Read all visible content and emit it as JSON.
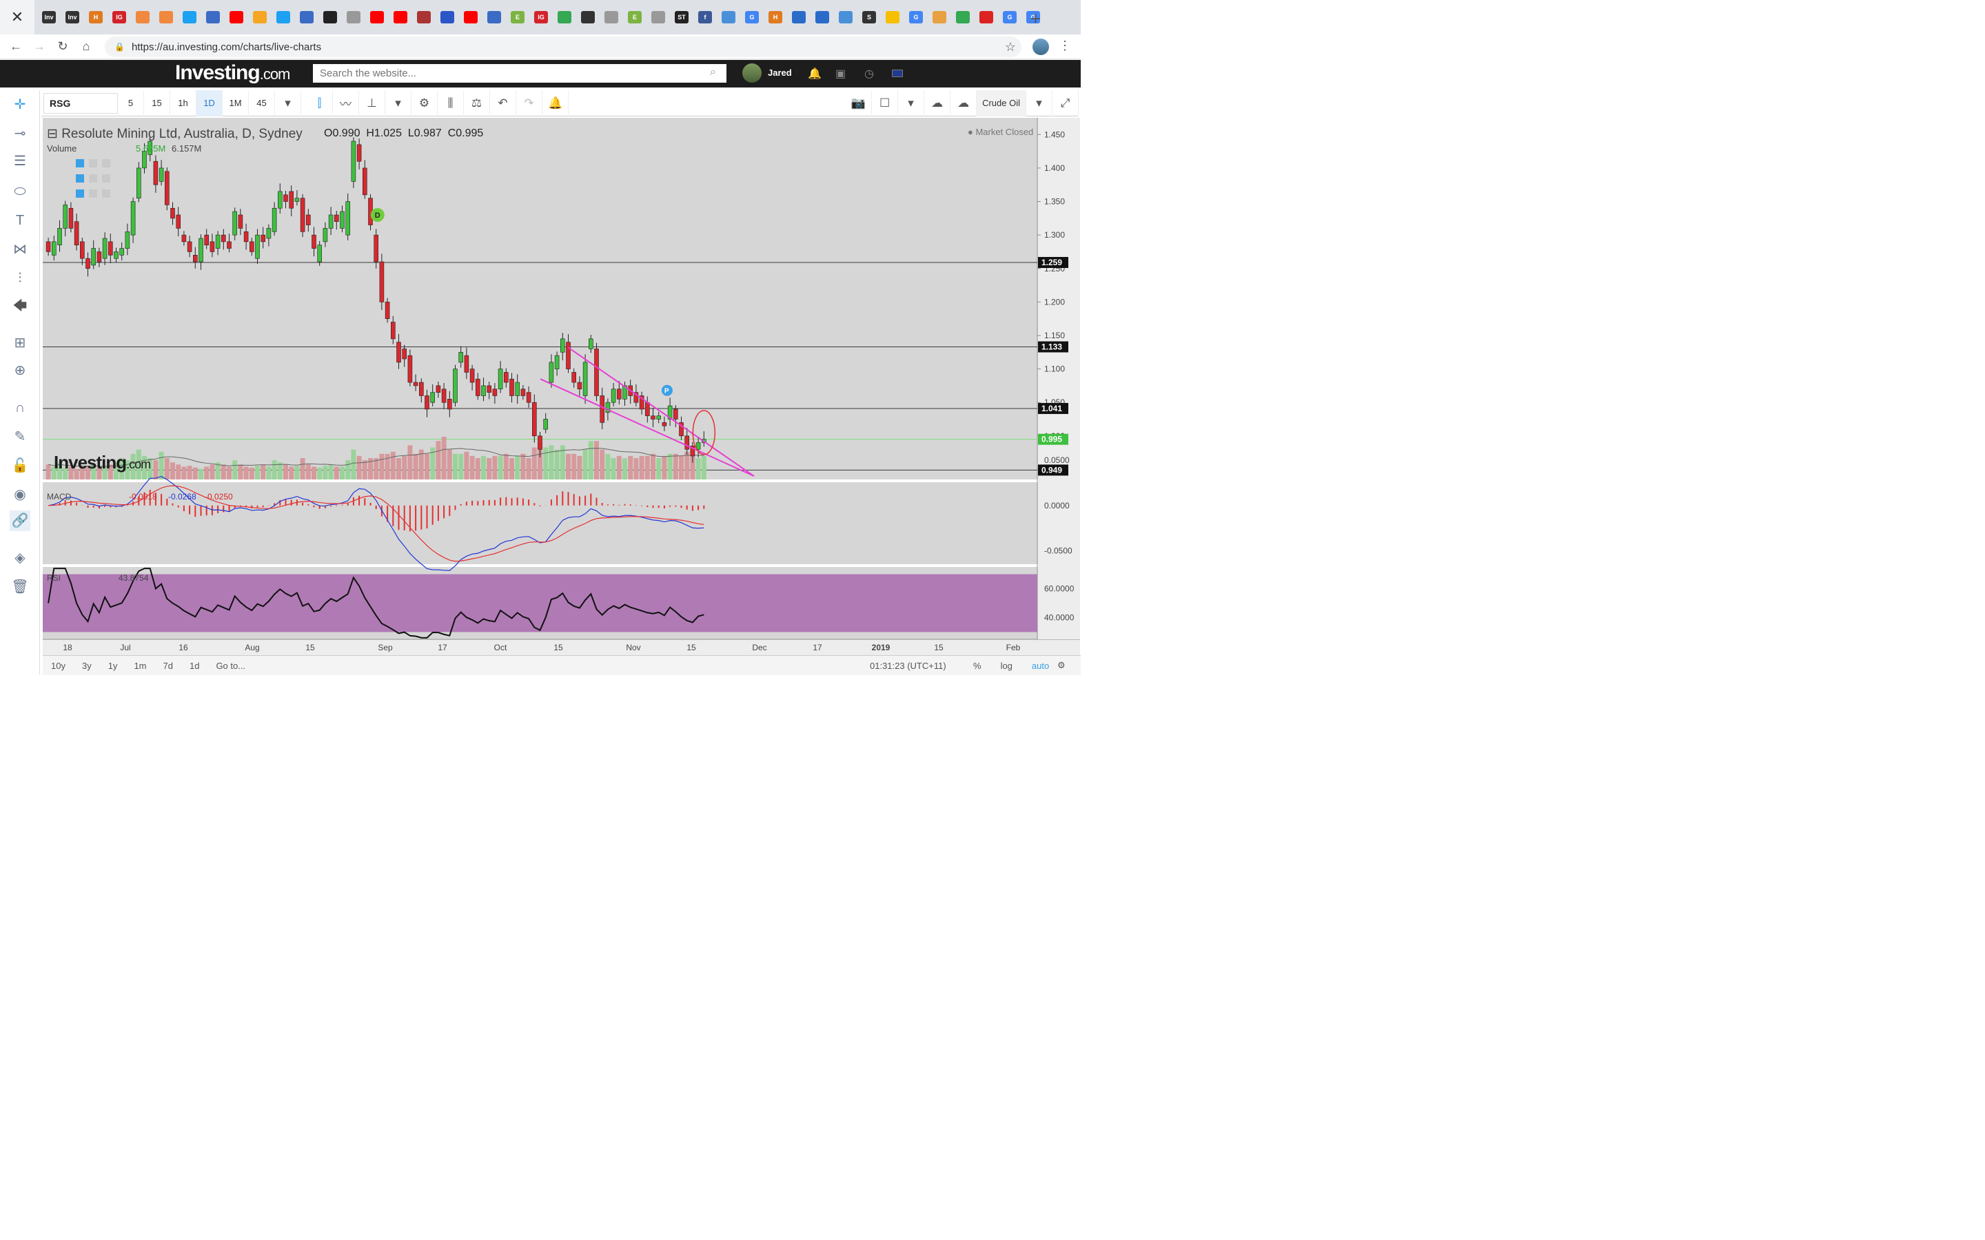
{
  "browser": {
    "url": "https://au.investing.com/charts/live-charts",
    "tab_icons": [
      {
        "label": "Inv",
        "color": "#333"
      },
      {
        "label": "Inv",
        "color": "#333"
      },
      {
        "label": "H",
        "color": "#e07a1f"
      },
      {
        "label": "IG",
        "color": "#d2232a"
      },
      {
        "label": "",
        "color": "#f0883e"
      },
      {
        "label": "",
        "color": "#f0883e"
      },
      {
        "label": "",
        "color": "#1da1f2"
      },
      {
        "label": "",
        "color": "#3b6bc4"
      },
      {
        "label": "",
        "color": "#ff0000"
      },
      {
        "label": "",
        "color": "#f5a623"
      },
      {
        "label": "",
        "color": "#1da1f2"
      },
      {
        "label": "",
        "color": "#3b6bc4"
      },
      {
        "label": "",
        "color": "#222"
      },
      {
        "label": "",
        "color": "#999"
      },
      {
        "label": "",
        "color": "#ff0000"
      },
      {
        "label": "",
        "color": "#ff0000"
      },
      {
        "label": "",
        "color": "#a33"
      },
      {
        "label": "",
        "color": "#2b56c8"
      },
      {
        "label": "",
        "color": "#ff0000"
      },
      {
        "label": "",
        "color": "#3b6bc4"
      },
      {
        "label": "E",
        "color": "#7cb342"
      },
      {
        "label": "IG",
        "color": "#d2232a"
      },
      {
        "label": "",
        "color": "#34a853"
      },
      {
        "label": "",
        "color": "#333"
      },
      {
        "label": "",
        "color": "#999"
      },
      {
        "label": "E",
        "color": "#7cb342"
      },
      {
        "label": "",
        "color": "#999"
      },
      {
        "label": "ST",
        "color": "#222"
      },
      {
        "label": "f",
        "color": "#3b5998"
      },
      {
        "label": "",
        "color": "#4a90d9"
      },
      {
        "label": "G",
        "color": "#4285f4"
      },
      {
        "label": "H",
        "color": "#e07a1f"
      },
      {
        "label": "",
        "color": "#2a6bc9"
      },
      {
        "label": "",
        "color": "#2a6bc9"
      },
      {
        "label": "",
        "color": "#4a90d9"
      },
      {
        "label": "S",
        "color": "#333"
      },
      {
        "label": "",
        "color": "#f6c000"
      },
      {
        "label": "G",
        "color": "#4285f4"
      },
      {
        "label": "",
        "color": "#e8a040"
      },
      {
        "label": "",
        "color": "#34a853"
      },
      {
        "label": "",
        "color": "#d22"
      },
      {
        "label": "G",
        "color": "#4285f4"
      },
      {
        "label": "G",
        "color": "#4285f4"
      }
    ]
  },
  "site": {
    "logo": "Investing",
    "logo_suffix": ".com",
    "search_placeholder": "Search the website...",
    "user": "Jared"
  },
  "toolbar": {
    "symbol": "RSG",
    "intervals": [
      "5",
      "15",
      "1h",
      "1D",
      "1M",
      "45"
    ],
    "active_interval": "1D",
    "instrument": "Crude Oil"
  },
  "legend": {
    "title": "Resolute Mining Ltd, Australia, D, Sydney",
    "open": "O0.990",
    "high": "H1.025",
    "low": "L0.987",
    "close": "C0.995",
    "market_status": "Market Closed",
    "volume_label": "Volume",
    "volume_v1": "5.625M",
    "volume_v2": "6.157M",
    "macd_label": "MACD",
    "macd_v1": "-0.0018",
    "macd_v2": "-0.0268",
    "macd_v3": "-0.0250",
    "rsi_label": "RSI",
    "rsi_value": "43.8754",
    "watermark": "Investing",
    "watermark_suffix": ".com"
  },
  "chart_data": {
    "type": "candlestick",
    "title": "Resolute Mining Ltd, Australia, D, Sydney",
    "y_range": [
      0.935,
      1.475
    ],
    "y_ticks": [
      "1.450",
      "1.400",
      "1.350",
      "1.300",
      "1.250",
      "1.200",
      "1.150",
      "1.100",
      "1.050",
      "1.000",
      "0.950"
    ],
    "price_labels": [
      {
        "value": 1.259,
        "label": "1.259",
        "style": "black"
      },
      {
        "value": 1.133,
        "label": "1.133",
        "style": "black"
      },
      {
        "value": 1.041,
        "label": "1.041",
        "style": "black"
      },
      {
        "value": 0.995,
        "label": "0.995",
        "style": "green"
      },
      {
        "value": 0.949,
        "label": "0.949",
        "style": "black"
      }
    ],
    "x_labels": [
      "18",
      "Jul",
      "16",
      "Aug",
      "15",
      "Sep",
      "17",
      "Oct",
      "15",
      "Nov",
      "15",
      "Dec",
      "17",
      "2019",
      "15",
      "Feb"
    ],
    "candles": [
      [
        1.29,
        1.275
      ],
      [
        1.27,
        1.29
      ],
      [
        1.285,
        1.31
      ],
      [
        1.31,
        1.345
      ],
      [
        1.34,
        1.31
      ],
      [
        1.32,
        1.285
      ],
      [
        1.29,
        1.265
      ],
      [
        1.265,
        1.25
      ],
      [
        1.255,
        1.28
      ],
      [
        1.275,
        1.26
      ],
      [
        1.265,
        1.295
      ],
      [
        1.29,
        1.27
      ],
      [
        1.265,
        1.275
      ],
      [
        1.27,
        1.28
      ],
      [
        1.28,
        1.305
      ],
      [
        1.3,
        1.35
      ],
      [
        1.355,
        1.4
      ],
      [
        1.4,
        1.425
      ],
      [
        1.42,
        1.44
      ],
      [
        1.41,
        1.375
      ],
      [
        1.38,
        1.4
      ],
      [
        1.395,
        1.345
      ],
      [
        1.34,
        1.325
      ],
      [
        1.33,
        1.31
      ],
      [
        1.3,
        1.29
      ],
      [
        1.29,
        1.275
      ],
      [
        1.27,
        1.26
      ],
      [
        1.26,
        1.295
      ],
      [
        1.3,
        1.285
      ],
      [
        1.29,
        1.275
      ],
      [
        1.28,
        1.3
      ],
      [
        1.3,
        1.29
      ],
      [
        1.29,
        1.28
      ],
      [
        1.3,
        1.335
      ],
      [
        1.33,
        1.31
      ],
      [
        1.305,
        1.29
      ],
      [
        1.29,
        1.275
      ],
      [
        1.265,
        1.3
      ],
      [
        1.3,
        1.29
      ],
      [
        1.295,
        1.31
      ],
      [
        1.305,
        1.34
      ],
      [
        1.34,
        1.365
      ],
      [
        1.36,
        1.35
      ],
      [
        1.365,
        1.34
      ],
      [
        1.35,
        1.355
      ],
      [
        1.355,
        1.305
      ],
      [
        1.33,
        1.315
      ],
      [
        1.3,
        1.28
      ],
      [
        1.26,
        1.285
      ],
      [
        1.29,
        1.31
      ],
      [
        1.31,
        1.33
      ],
      [
        1.33,
        1.32
      ],
      [
        1.31,
        1.335
      ],
      [
        1.3,
        1.35
      ],
      [
        1.38,
        1.44
      ],
      [
        1.435,
        1.41
      ],
      [
        1.4,
        1.36
      ],
      [
        1.355,
        1.315
      ],
      [
        1.3,
        1.26
      ],
      [
        1.26,
        1.2
      ],
      [
        1.2,
        1.175
      ],
      [
        1.17,
        1.145
      ],
      [
        1.14,
        1.11
      ],
      [
        1.13,
        1.115
      ],
      [
        1.12,
        1.08
      ],
      [
        1.08,
        1.075
      ],
      [
        1.08,
        1.06
      ],
      [
        1.06,
        1.04
      ],
      [
        1.05,
        1.065
      ],
      [
        1.075,
        1.065
      ],
      [
        1.07,
        1.05
      ],
      [
        1.055,
        1.04
      ],
      [
        1.05,
        1.1
      ],
      [
        1.11,
        1.125
      ],
      [
        1.12,
        1.095
      ],
      [
        1.1,
        1.08
      ],
      [
        1.085,
        1.06
      ],
      [
        1.06,
        1.075
      ],
      [
        1.075,
        1.065
      ],
      [
        1.07,
        1.06
      ],
      [
        1.07,
        1.1
      ],
      [
        1.095,
        1.08
      ],
      [
        1.085,
        1.06
      ],
      [
        1.06,
        1.08
      ],
      [
        1.07,
        1.06
      ],
      [
        1.065,
        1.05
      ],
      [
        1.05,
        1.0
      ],
      [
        1.0,
        0.98
      ],
      [
        1.01,
        1.025
      ],
      [
        1.08,
        1.11
      ],
      [
        1.1,
        1.12
      ],
      [
        1.125,
        1.145
      ],
      [
        1.14,
        1.1
      ],
      [
        1.095,
        1.08
      ],
      [
        1.08,
        1.07
      ],
      [
        1.06,
        1.11
      ],
      [
        1.13,
        1.145
      ],
      [
        1.13,
        1.06
      ],
      [
        1.06,
        1.02
      ],
      [
        1.035,
        1.05
      ],
      [
        1.05,
        1.07
      ],
      [
        1.07,
        1.055
      ],
      [
        1.055,
        1.075
      ],
      [
        1.075,
        1.06
      ],
      [
        1.065,
        1.05
      ],
      [
        1.06,
        1.04
      ],
      [
        1.05,
        1.03
      ],
      [
        1.03,
        1.025
      ],
      [
        1.025,
        1.03
      ],
      [
        1.02,
        1.015
      ],
      [
        1.025,
        1.045
      ],
      [
        1.04,
        1.025
      ],
      [
        1.02,
        1.0
      ],
      [
        1.0,
        0.98
      ],
      [
        0.985,
        0.97
      ],
      [
        0.98,
        0.99
      ],
      [
        0.99,
        0.995
      ]
    ],
    "volumes": [
      0.35,
      0.3,
      0.4,
      0.28,
      0.3,
      0.25,
      0.32,
      0.3,
      0.35,
      0.28,
      0.3,
      0.35,
      0.4,
      0.5,
      0.45,
      0.6,
      0.7,
      0.55,
      0.5,
      0.45,
      0.65,
      0.5,
      0.4,
      0.35,
      0.3,
      0.32,
      0.28,
      0.25,
      0.3,
      0.35,
      0.4,
      0.35,
      0.3,
      0.45,
      0.35,
      0.3,
      0.28,
      0.32,
      0.35,
      0.3,
      0.45,
      0.4,
      0.35,
      0.3,
      0.32,
      0.5,
      0.35,
      0.3,
      0.28,
      0.32,
      0.35,
      0.3,
      0.3,
      0.45,
      0.7,
      0.55,
      0.45,
      0.5,
      0.5,
      0.6,
      0.6,
      0.65,
      0.5,
      0.55,
      0.8,
      0.6,
      0.7,
      0.6,
      0.75,
      0.9,
      1.0,
      0.7,
      0.6,
      0.6,
      0.65,
      0.55,
      0.5,
      0.55,
      0.5,
      0.55,
      0.55,
      0.6,
      0.5,
      0.55,
      0.6,
      0.5,
      0.75,
      0.85,
      0.75,
      0.8,
      0.7,
      0.8,
      0.6,
      0.6,
      0.55,
      0.7,
      0.9,
      0.9,
      0.7,
      0.6,
      0.5,
      0.55,
      0.5,
      0.55,
      0.5,
      0.55,
      0.55,
      0.6,
      0.5,
      0.55,
      0.6,
      0.6,
      0.55,
      0.65,
      0.55,
      0.5,
      0.55
    ],
    "macd": {
      "y_range": [
        -0.065,
        0.025
      ],
      "y_ticks": [
        "0.0500",
        "0.0000",
        "-0.0500"
      ]
    },
    "rsi": {
      "y_range": [
        25,
        75
      ],
      "y_ticks": [
        "60.0000",
        "40.0000"
      ]
    },
    "markers": [
      {
        "label": "D",
        "color": "#6fcc3a"
      },
      {
        "label": "P",
        "color": "#3aa0e8"
      }
    ],
    "trendline_color": "#e63fd4",
    "up_color": "#3fbf3f",
    "down_color": "#d8282e"
  },
  "bottom": {
    "ranges": [
      "10y",
      "3y",
      "1y",
      "1m",
      "7d",
      "1d",
      "Go to..."
    ],
    "time": "01:31:23 (UTC+11)",
    "opts": [
      "%",
      "log",
      "auto"
    ]
  }
}
